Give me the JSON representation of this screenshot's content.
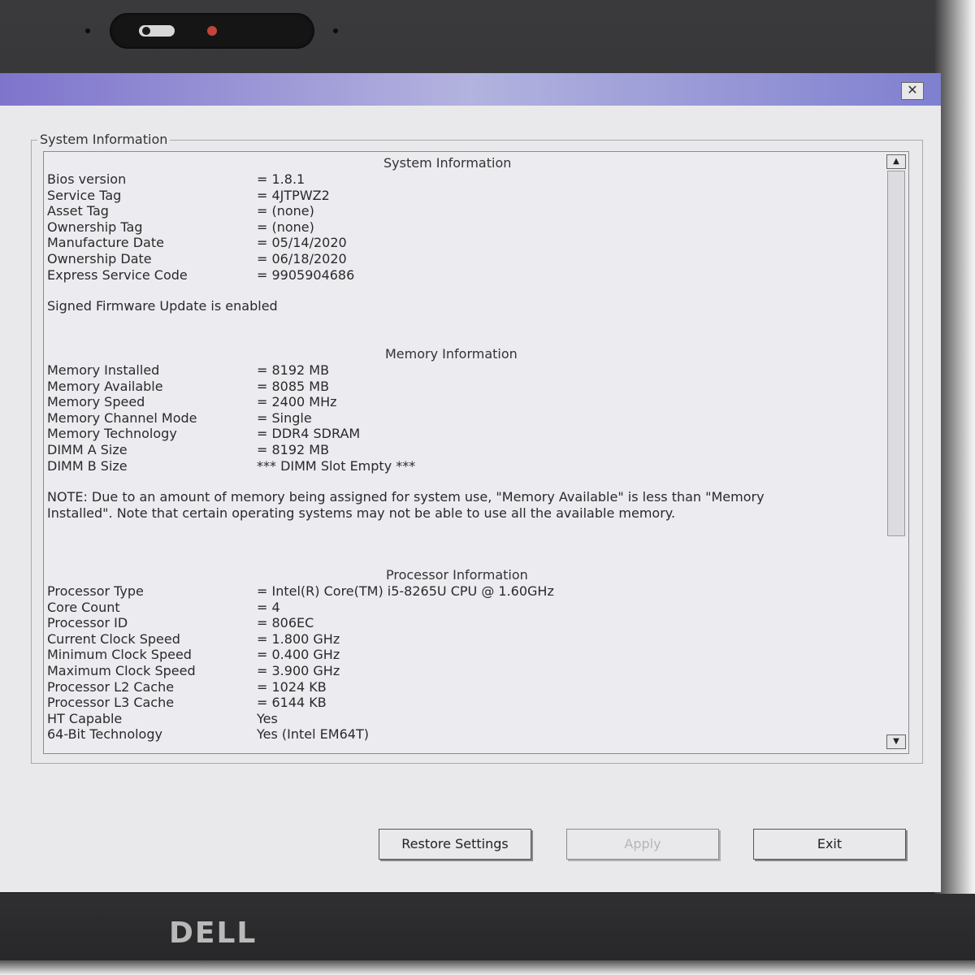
{
  "brand": {
    "logo_text": "DELL"
  },
  "window": {
    "close_label": "✕"
  },
  "group_title": "System Information",
  "system": {
    "heading": "System Information",
    "rows": [
      {
        "label": "Bios version",
        "value": "= 1.8.1"
      },
      {
        "label": "Service Tag",
        "value": "= 4JTPWZ2"
      },
      {
        "label": "Asset Tag",
        "value": "= (none)"
      },
      {
        "label": "Ownership Tag",
        "value": "= (none)"
      },
      {
        "label": "Manufacture Date",
        "value": "= 05/14/2020"
      },
      {
        "label": "Ownership Date",
        "value": "= 06/18/2020"
      },
      {
        "label": "Express Service Code",
        "value": "= 9905904686"
      }
    ],
    "firmware_note": "Signed Firmware Update is enabled"
  },
  "memory": {
    "heading": "Memory Information",
    "rows": [
      {
        "label": "Memory Installed",
        "value": "= 8192 MB"
      },
      {
        "label": "Memory Available",
        "value": "= 8085 MB"
      },
      {
        "label": "Memory Speed",
        "value": "= 2400 MHz"
      },
      {
        "label": "Memory Channel Mode",
        "value": "= Single"
      },
      {
        "label": "Memory Technology",
        "value": "= DDR4 SDRAM"
      },
      {
        "label": "DIMM A Size",
        "value": "= 8192 MB"
      },
      {
        "label": "DIMM B Size",
        "value": "*** DIMM Slot Empty ***"
      }
    ],
    "note": "NOTE: Due to an amount of memory being assigned for system use, \"Memory Available\" is less than \"Memory Installed\". Note that certain operating systems may not be able to use all the available memory."
  },
  "processor": {
    "heading": "Processor Information",
    "rows": [
      {
        "label": "Processor Type",
        "value": "= Intel(R) Core(TM) i5-8265U CPU @ 1.60GHz"
      },
      {
        "label": "Core Count",
        "value": "= 4"
      },
      {
        "label": "Processor ID",
        "value": "= 806EC"
      },
      {
        "label": "Current Clock Speed",
        "value": "= 1.800 GHz"
      },
      {
        "label": "Minimum Clock Speed",
        "value": "= 0.400 GHz"
      },
      {
        "label": "Maximum Clock Speed",
        "value": "= 3.900 GHz"
      },
      {
        "label": "Processor L2 Cache",
        "value": "= 1024 KB"
      },
      {
        "label": "Processor L3 Cache",
        "value": "= 6144 KB"
      },
      {
        "label": "HT Capable",
        "value": "Yes"
      },
      {
        "label": "64-Bit Technology",
        "value": "Yes (Intel EM64T)"
      }
    ]
  },
  "buttons": {
    "restore": "Restore Settings",
    "apply": "Apply",
    "exit": "Exit"
  },
  "scrollbar": {
    "up": "▲",
    "down": "▼"
  }
}
